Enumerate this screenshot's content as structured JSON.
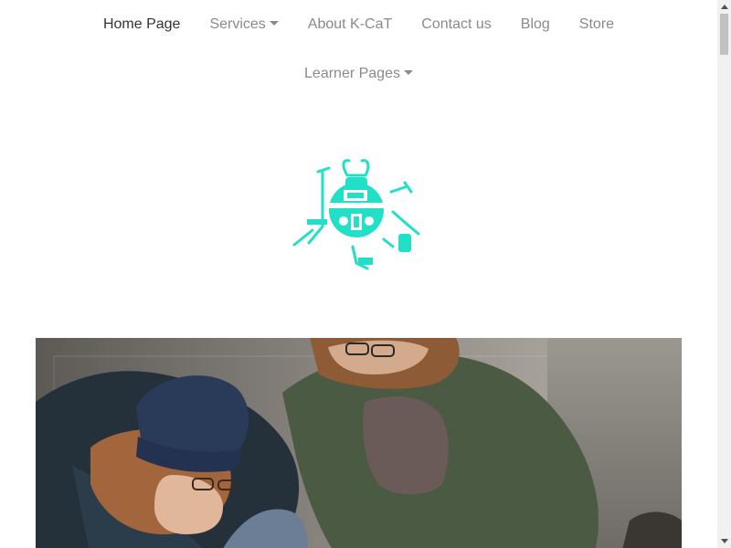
{
  "nav": {
    "items": [
      {
        "label": "Home Page",
        "active": true,
        "dropdown": false
      },
      {
        "label": "Services",
        "active": false,
        "dropdown": true
      },
      {
        "label": "About K-CaT",
        "active": false,
        "dropdown": false
      },
      {
        "label": "Contact us",
        "active": false,
        "dropdown": false
      },
      {
        "label": "Blog",
        "active": false,
        "dropdown": false
      },
      {
        "label": "Store",
        "active": false,
        "dropdown": false
      }
    ],
    "second_row": {
      "label": "Learner Pages",
      "dropdown": true
    }
  },
  "logo": {
    "icon": "robot-bug-logo-icon",
    "color": "#22e0c8"
  },
  "hero": {
    "icon": "hero-photo-two-people-crouching"
  },
  "colors": {
    "nav_active": "#333333",
    "nav_inactive": "#8a8a8a",
    "logo": "#22e0c8"
  }
}
